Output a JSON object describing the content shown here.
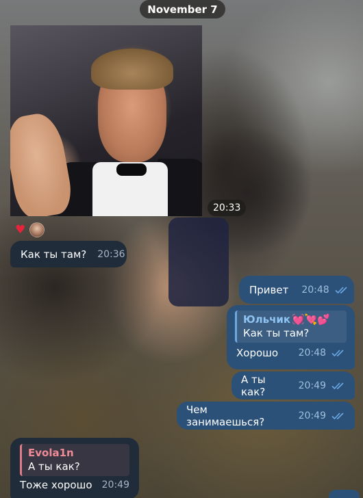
{
  "chat": {
    "date_separator": "November 7",
    "media_message": {
      "time": "20:33",
      "reactions": {
        "heart": "♥"
      }
    },
    "messages": [
      {
        "text": "Как ты там?",
        "time": "20:36"
      },
      {
        "text": "Привет",
        "time": "20:48"
      },
      {
        "reply_name": "Юльчик",
        "reply_emoji": "💓💘💕",
        "reply_text": "Как ты там?",
        "text": "Хорошо",
        "time": "20:48"
      },
      {
        "text": "А ты как?",
        "time": "20:49"
      },
      {
        "text": "Чем занимаешься?",
        "time": "20:49"
      },
      {
        "reply_name": "Evola1n",
        "reply_text": "А ты как?",
        "text": "Тоже хорошо",
        "time": "20:49"
      }
    ]
  },
  "colors": {
    "incoming_bubble": "#212c3a",
    "outgoing_bubble": "#2b5178",
    "read_check": "#6aa9e6",
    "reaction_heart": "#e8243c"
  }
}
